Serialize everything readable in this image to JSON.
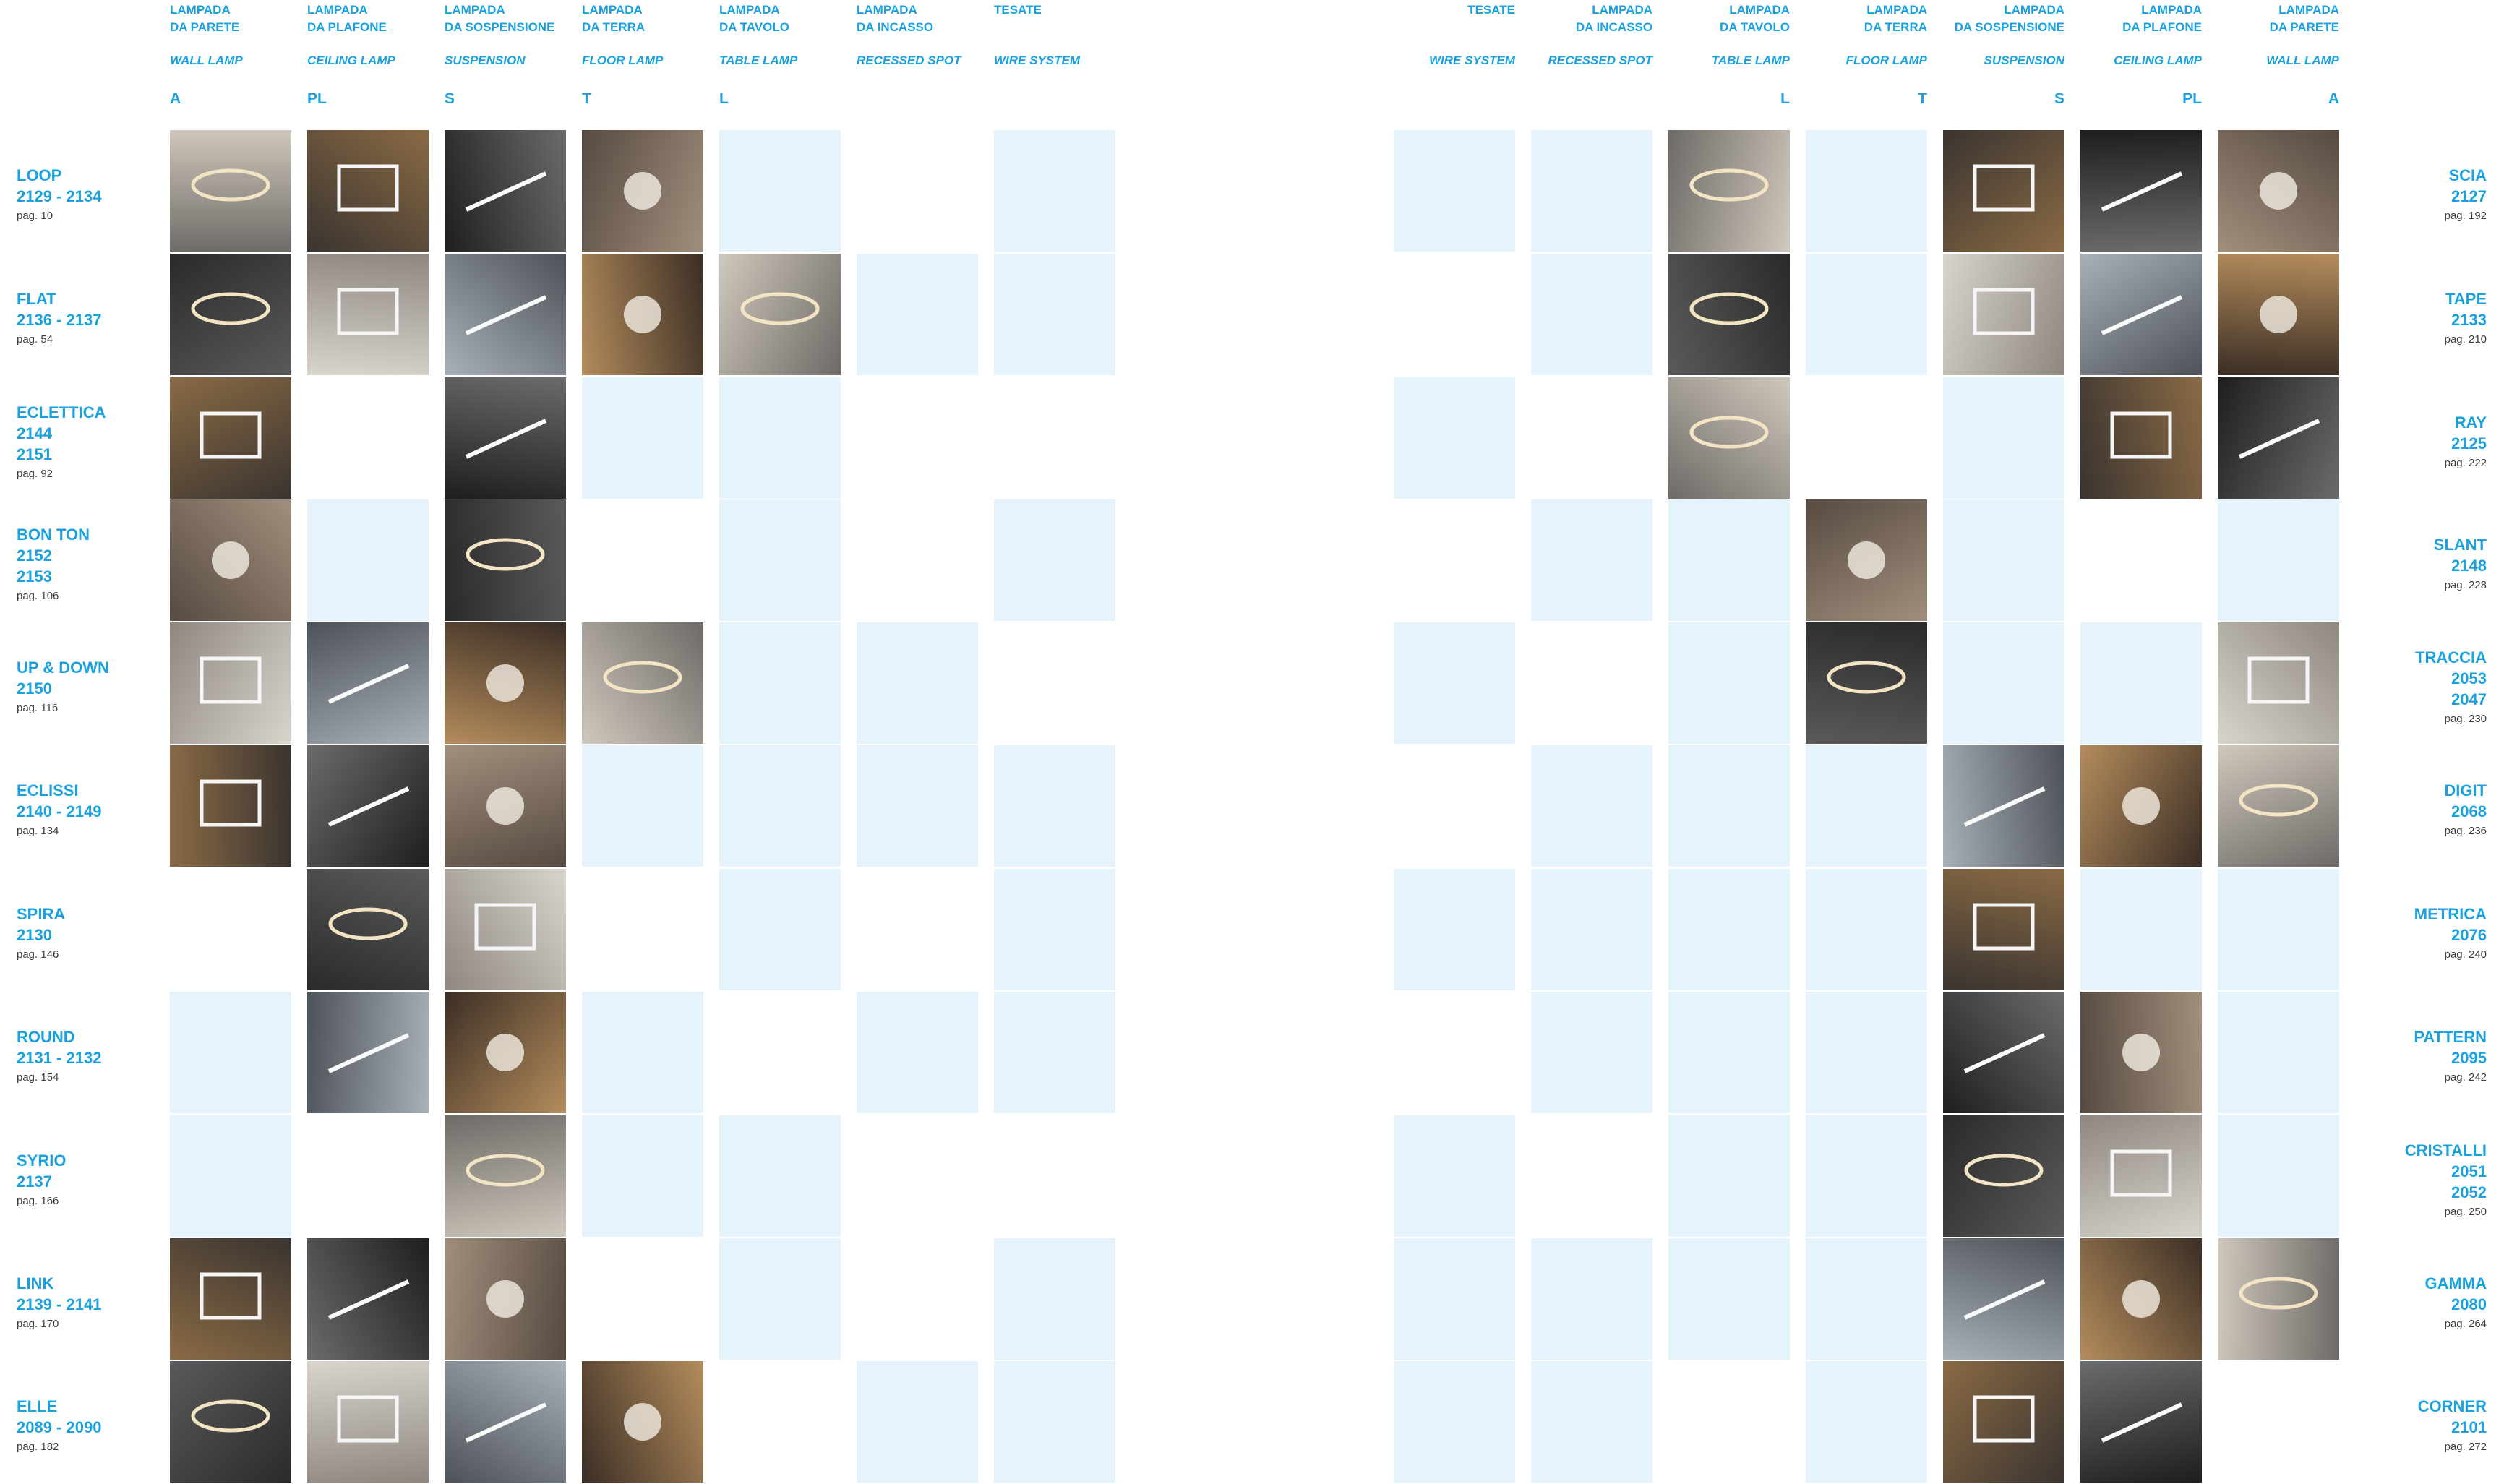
{
  "left_headers": [
    {
      "line1": "LAMPADA",
      "line2": "DA PARETE",
      "eng": "WALL LAMP",
      "code": "A"
    },
    {
      "line1": "LAMPADA",
      "line2": "DA PLAFONE",
      "eng": "CEILING LAMP",
      "code": "PL"
    },
    {
      "line1": "LAMPADA",
      "line2": "DA SOSPENSIONE",
      "eng": "SUSPENSION",
      "code": "S"
    },
    {
      "line1": "LAMPADA",
      "line2": "DA TERRA",
      "eng": "FLOOR LAMP",
      "code": "T"
    },
    {
      "line1": "LAMPADA",
      "line2": "DA TAVOLO",
      "eng": "TABLE LAMP",
      "code": "L"
    },
    {
      "line1": "LAMPADA",
      "line2": "DA INCASSO",
      "eng": "RECESSED SPOT",
      "code": ""
    },
    {
      "line1": "TESATE",
      "line2": "",
      "eng": "WIRE SYSTEM",
      "code": ""
    }
  ],
  "right_headers": [
    {
      "line1": "TESATE",
      "line2": "",
      "eng": "WIRE SYSTEM",
      "code": ""
    },
    {
      "line1": "LAMPADA",
      "line2": "DA INCASSO",
      "eng": "RECESSED SPOT",
      "code": ""
    },
    {
      "line1": "LAMPADA",
      "line2": "DA TAVOLO",
      "eng": "TABLE LAMP",
      "code": "L"
    },
    {
      "line1": "LAMPADA",
      "line2": "DA TERRA",
      "eng": "FLOOR LAMP",
      "code": "T"
    },
    {
      "line1": "LAMPADA",
      "line2": "DA SOSPENSIONE",
      "eng": "SUSPENSION",
      "code": "S"
    },
    {
      "line1": "LAMPADA",
      "line2": "DA PLAFONE",
      "eng": "CEILING LAMP",
      "code": "PL"
    },
    {
      "line1": "LAMPADA",
      "line2": "DA PARETE",
      "eng": "WALL LAMP",
      "code": "A"
    }
  ],
  "left_rows": [
    {
      "name": "LOOP",
      "codes": [
        "2129 - 2134"
      ],
      "page": "pag. 10"
    },
    {
      "name": "FLAT",
      "codes": [
        "2136 - 2137"
      ],
      "page": "pag. 54"
    },
    {
      "name": "ECLETTICA",
      "codes": [
        "2144",
        "2151"
      ],
      "page": "pag. 92"
    },
    {
      "name": "BON TON",
      "codes": [
        "2152",
        "2153"
      ],
      "page": "pag. 106"
    },
    {
      "name": "UP & DOWN",
      "codes": [
        "2150"
      ],
      "page": "pag. 116"
    },
    {
      "name": "ECLISSI",
      "codes": [
        "2140 - 2149"
      ],
      "page": "pag. 134"
    },
    {
      "name": "SPIRA",
      "codes": [
        "2130"
      ],
      "page": "pag. 146"
    },
    {
      "name": "ROUND",
      "codes": [
        "2131 - 2132"
      ],
      "page": "pag. 154"
    },
    {
      "name": "SYRIO",
      "codes": [
        "2137"
      ],
      "page": "pag. 166"
    },
    {
      "name": "LINK",
      "codes": [
        "2139 - 2141"
      ],
      "page": "pag. 170"
    },
    {
      "name": "ELLE",
      "codes": [
        "2089 - 2090"
      ],
      "page": "pag. 182"
    }
  ],
  "right_rows": [
    {
      "name": "SCIA",
      "codes": [
        "2127"
      ],
      "page": "pag. 192"
    },
    {
      "name": "TAPE",
      "codes": [
        "2133"
      ],
      "page": "pag. 210"
    },
    {
      "name": "RAY",
      "codes": [
        "2125"
      ],
      "page": "pag. 222"
    },
    {
      "name": "SLANT",
      "codes": [
        "2148"
      ],
      "page": "pag. 228"
    },
    {
      "name": "TRACCIA",
      "codes": [
        "2053",
        "2047"
      ],
      "page": "pag. 230"
    },
    {
      "name": "DIGIT",
      "codes": [
        "2068"
      ],
      "page": "pag. 236"
    },
    {
      "name": "METRICA",
      "codes": [
        "2076"
      ],
      "page": "pag. 240"
    },
    {
      "name": "PATTERN",
      "codes": [
        "2095"
      ],
      "page": "pag. 242"
    },
    {
      "name": "CRISTALLI",
      "codes": [
        "2051",
        "2052"
      ],
      "page": "pag. 250"
    },
    {
      "name": "GAMMA",
      "codes": [
        "2080"
      ],
      "page": "pag. 264"
    },
    {
      "name": "CORNER",
      "codes": [
        "2101"
      ],
      "page": "pag. 272"
    }
  ],
  "left_grid": [
    [
      "p",
      "p",
      "p",
      "p",
      "e",
      "n",
      "e"
    ],
    [
      "p",
      "p",
      "p",
      "p",
      "p",
      "e",
      "e"
    ],
    [
      "p",
      "n",
      "p",
      "e",
      "e",
      "n",
      "n"
    ],
    [
      "p",
      "e",
      "p",
      "n",
      "e",
      "n",
      "e"
    ],
    [
      "p",
      "p",
      "p",
      "p",
      "e",
      "e",
      "n"
    ],
    [
      "p",
      "p",
      "p",
      "e",
      "e",
      "e",
      "e"
    ],
    [
      "n",
      "p",
      "p",
      "n",
      "e",
      "n",
      "e"
    ],
    [
      "e",
      "p",
      "p",
      "e",
      "n",
      "e",
      "e"
    ],
    [
      "e",
      "n",
      "p",
      "e",
      "e",
      "n",
      "n"
    ],
    [
      "p",
      "p",
      "p",
      "n",
      "e",
      "n",
      "e"
    ],
    [
      "p",
      "p",
      "p",
      "p",
      "n",
      "e",
      "e"
    ]
  ],
  "right_grid": [
    [
      "e",
      "e",
      "p",
      "e",
      "p",
      "p",
      "p"
    ],
    [
      "n",
      "e",
      "p",
      "e",
      "p",
      "p",
      "p"
    ],
    [
      "e",
      "n",
      "p",
      "n",
      "e",
      "p",
      "p"
    ],
    [
      "n",
      "e",
      "e",
      "p",
      "e",
      "n",
      "e"
    ],
    [
      "e",
      "n",
      "e",
      "p",
      "e",
      "e",
      "p"
    ],
    [
      "n",
      "e",
      "e",
      "e",
      "p",
      "p",
      "p"
    ],
    [
      "e",
      "e",
      "e",
      "e",
      "p",
      "e",
      "e"
    ],
    [
      "n",
      "e",
      "e",
      "e",
      "p",
      "p",
      "e"
    ],
    [
      "e",
      "n",
      "e",
      "e",
      "p",
      "p",
      "e"
    ],
    [
      "e",
      "e",
      "e",
      "e",
      "p",
      "p",
      "p"
    ],
    [
      "e",
      "e",
      "n",
      "e",
      "p",
      "p",
      "n"
    ]
  ],
  "colors": {
    "accent": "#1aa1de",
    "empty_cell": "#e4f3fc",
    "page_text": "#3d3d3d"
  }
}
